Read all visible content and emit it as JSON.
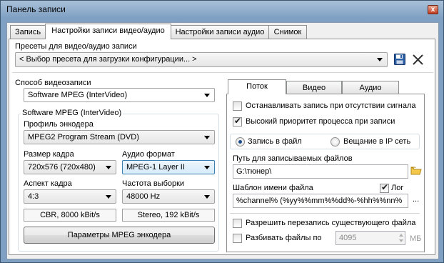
{
  "window": {
    "title": "Панель записи",
    "close_glyph": "x"
  },
  "tabs": [
    {
      "label": "Запись",
      "active": false
    },
    {
      "label": "Настройки записи видео/аудио",
      "active": true
    },
    {
      "label": "Настройки записи аудио",
      "active": false
    },
    {
      "label": "Снимок",
      "active": false
    }
  ],
  "presets": {
    "label": "Пресеты для видео/аудио записи",
    "value": "< Выбор пресета для загрузки конфигурации... >",
    "icons": [
      "save-icon",
      "close-icon"
    ]
  },
  "capture_method": {
    "label": "Способ видеозаписи",
    "value": "Software MPEG (InterVideo)"
  },
  "encoder_group": {
    "label": "Software MPEG (InterVideo)",
    "profile_label": "Профиль энкодера",
    "profile_value": "MPEG2 Program Stream (DVD)",
    "frame_size_label": "Размер кадра",
    "frame_size_value": "720x576 (720x480)",
    "audio_format_label": "Аудио формат",
    "audio_format_value": "MPEG-1 Layer II",
    "aspect_label": "Аспект кадра",
    "aspect_value": "4:3",
    "sample_rate_label": "Частота выборки",
    "sample_rate_value": "48000 Hz",
    "video_info": "CBR, 8000 kBit/s",
    "audio_info": "Stereo, 192 kBit/s",
    "params_button": "Параметры MPEG энкодера"
  },
  "inner_tabs": [
    {
      "label": "Поток",
      "active": true
    },
    {
      "label": "Видео",
      "active": false
    },
    {
      "label": "Аудио",
      "active": false
    }
  ],
  "stream": {
    "stop_no_signal": {
      "label": "Останавливать запись при отсутствии сигнала",
      "checked": false
    },
    "high_priority": {
      "label": "Высокий приоритет процесса при записи",
      "checked": true
    },
    "record_to_file": {
      "label": "Запись в файл",
      "selected": true
    },
    "broadcast_ip": {
      "label": "Вещание в IP сеть",
      "selected": false
    },
    "path_label": "Путь для записываемых файлов",
    "path_value": "G:\\тюнер\\",
    "folder_icon": "folder-icon",
    "template_label": "Шаблон имени файла",
    "log_label": "Лог",
    "log_checked": true,
    "template_value": "%channel% (%yy%%mm%%dd%-%hh%%nn%",
    "template_more": "...",
    "allow_overwrite": {
      "label": "Разрешить перезапись существующего файла",
      "checked": false
    },
    "split_files": {
      "label": "Разбивать файлы по",
      "checked": false
    },
    "split_size": "4095",
    "split_unit": "МБ"
  },
  "colors": {
    "title_bar": "#7fa0c3",
    "accent": "#3c7fb1"
  }
}
